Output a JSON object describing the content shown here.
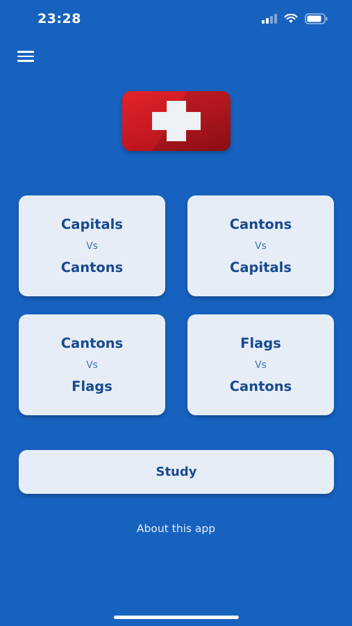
{
  "status_bar": {
    "time": "23:28"
  },
  "menu": {
    "icon": "hamburger-menu-icon"
  },
  "flag": {
    "icon": "swiss-flag-icon",
    "colors": {
      "field": "#d71f27",
      "cross": "#eef2f4"
    }
  },
  "quiz_cards": [
    {
      "top": "Capitals",
      "vs": "Vs",
      "bottom": "Cantons"
    },
    {
      "top": "Cantons",
      "vs": "Vs",
      "bottom": "Capitals"
    },
    {
      "top": "Cantons",
      "vs": "Vs",
      "bottom": "Flags"
    },
    {
      "top": "Flags",
      "vs": "Vs",
      "bottom": "Cantons"
    }
  ],
  "study_button": {
    "label": "Study"
  },
  "about_link": {
    "label": "About this app"
  },
  "colors": {
    "background": "#1762bf",
    "card": "#e7edf6",
    "card_text": "#174a8f",
    "vs_text": "#3f74b6"
  }
}
